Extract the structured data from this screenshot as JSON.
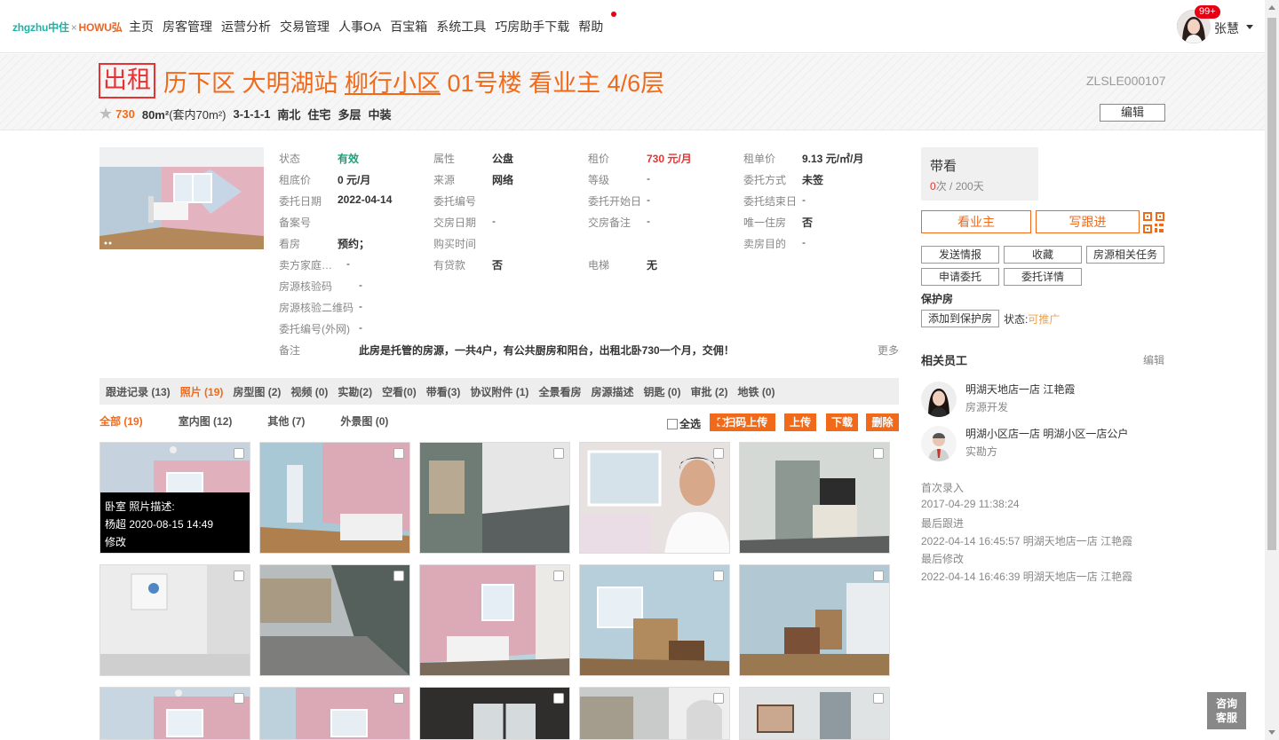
{
  "nav": {
    "logo_zhgzhu": "zhgzhu",
    "logo_zhongzhu": "中住",
    "logo_x": "×",
    "logo_howu": "HOWU弘",
    "menu": [
      "主页",
      "房客管理",
      "运营分析",
      "交易管理",
      "人事OA",
      "百宝箱",
      "系统工具",
      "巧房助手下载",
      "帮助"
    ],
    "badge": "99+",
    "username": "张慧"
  },
  "title": {
    "tag": "出租",
    "district": "历下区 大明湖站",
    "community": "柳行小区",
    "rest": "01号楼 看业主 4/6层",
    "code": "ZLSLE000107",
    "edit": "编辑"
  },
  "summary": {
    "price": "730",
    "area": "80m²",
    "inner_area": "(套内70m²)",
    "layout": "3-1-1-1",
    "orientation": "南北",
    "usage": "住宅",
    "floor_type": "多层",
    "decoration": "中装"
  },
  "info": {
    "status_k": "状态",
    "status_v": "有效",
    "attr_k": "属性",
    "attr_v": "公盘",
    "rent_k": "租价",
    "rent_v": "730 元/月",
    "unit_k": "租单价",
    "unit_v": "9.13 元/㎡/月",
    "floor_price_k": "租底价",
    "floor_price_v": "0 元/月",
    "source_k": "来源",
    "source_v": "网络",
    "level_k": "等级",
    "level_v": "-",
    "entrust_way_k": "委托方式",
    "entrust_way_v": "未签",
    "entrust_date_k": "委托日期",
    "entrust_date_v": "2022-04-14",
    "entrust_no_k": "委托编号",
    "entrust_no_v": "",
    "entrust_start_k": "委托开始日",
    "entrust_start_v": "-",
    "entrust_end_k": "委托结束日",
    "entrust_end_v": "-",
    "record_no_k": "备案号",
    "record_no_v": "",
    "handover_date_k": "交房日期",
    "handover_date_v": "-",
    "handover_note_k": "交房备注",
    "handover_note_v": "-",
    "only_house_k": "唯一住房",
    "only_house_v": "否",
    "viewing_k": "看房",
    "viewing_v": "预约；",
    "purchase_time_k": "购买时间",
    "purchase_time_v": "",
    "sell_purpose_k": "卖房目的",
    "sell_purpose_v": "-",
    "seller_family_k": "卖方家庭…",
    "seller_family_v": "-",
    "loan_k": "有贷款",
    "loan_v": "否",
    "elevator_k": "电梯",
    "elevator_v": "无",
    "verify_code_k": "房源核验码",
    "verify_code_v": "-",
    "verify_qr_k": "房源核验二维码",
    "verify_qr_v": "-",
    "entrust_online_k": "委托编号(外网)",
    "entrust_online_v": "-",
    "remark_k": "备注",
    "remark_v": "此房是托管的房源，一共4户，有公共厨房和阳台，出租北卧730一个月，交佣！",
    "more": "更多"
  },
  "right": {
    "daikan_title": "带看",
    "daikan_count": "0",
    "daikan_rest": "次 / 200天",
    "btn_see_owner": "看业主",
    "btn_write_follow": "写跟进",
    "btn_send": "发送情报",
    "btn_fav": "收藏",
    "btn_task": "房源相关任务",
    "btn_apply": "申请委托",
    "btn_entrust_detail": "委托详情",
    "protect_title": "保护房",
    "btn_add_protect": "添加到保护房",
    "status_label": "状态:",
    "status_value": "可推广",
    "staff_title": "相关员工",
    "staff_edit": "编辑",
    "staff": [
      {
        "name": "明湖天地店一店 江艳霞",
        "role": "房源开发"
      },
      {
        "name": "明湖小区店一店 明湖小区一店公户",
        "role": "实勘方"
      }
    ],
    "log": [
      "首次录入",
      "2017-04-29 11:38:24",
      "最后跟进",
      "2022-04-14 16:45:57 明湖天地店一店 江艳霞",
      "最后修改",
      "2022-04-14 16:46:39 明湖天地店一店 江艳霞"
    ]
  },
  "tabs": [
    "跟进记录 (13)",
    "照片 (19)",
    "房型图 (2)",
    "视频 (0)",
    "实勘(2)",
    "空看(0)",
    "带看(3)",
    "协议附件 (1)",
    "全景看房",
    "房源描述",
    "钥匙 (0)",
    "审批 (2)",
    "地铁 (0)"
  ],
  "subtabs": [
    "全部 (19)",
    "室内图 (12)",
    "其他 (7)",
    "外景图 (0)"
  ],
  "gallery": {
    "select_all": "全选",
    "scan_upload": "扫码上传",
    "upload": "上传",
    "download": "下载",
    "delete": "删除",
    "overlay_line1": "卧室    照片描述:",
    "overlay_line2": "杨超 2020-08-15 14:49",
    "overlay_line3": "修改"
  },
  "consult": {
    "line1": "咨询",
    "line2": "客服"
  },
  "colors": {
    "accent": "#f06a1a",
    "red": "#e53333",
    "green": "#1aa179"
  }
}
